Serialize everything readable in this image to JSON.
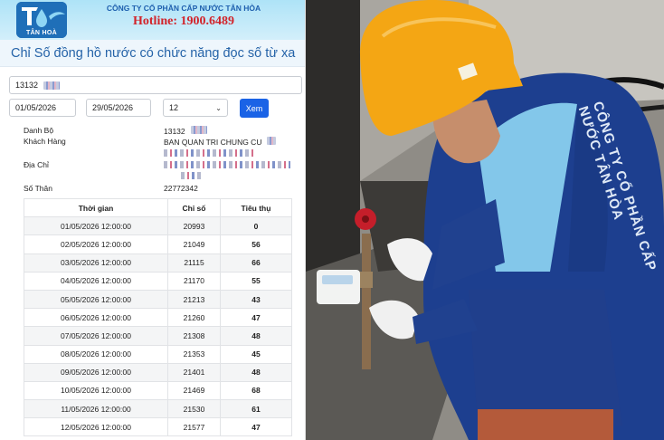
{
  "header": {
    "logo_text": "TÂN HOÀ",
    "company_name": "CÔNG TY CỔ PHẦN CẤP NƯỚC TÂN HÒA",
    "hotline": "Hotline: 1900.6489"
  },
  "page_title": "Chỉ Số đồng hồ nước có chức năng đọc số từ xa",
  "filters": {
    "account_value": "13132",
    "from_date": "01/05/2026",
    "to_date": "29/05/2026",
    "hour_value": "12",
    "search_button": "Xem"
  },
  "info": {
    "danh_bo_label": "Danh Bộ",
    "danh_bo_value": "13132",
    "customer_label": "Khách Hàng",
    "customer_value": "BAN QUAN TRI CHUNG CU",
    "address_label": "Địa Chỉ",
    "serial_label": "Số Thân",
    "serial_value": "22772342"
  },
  "table": {
    "headers": [
      "Thời gian",
      "Chỉ số",
      "Tiêu thụ"
    ],
    "rows": [
      [
        "01/05/2026 12:00:00",
        "20993",
        "0"
      ],
      [
        "02/05/2026 12:00:00",
        "21049",
        "56"
      ],
      [
        "03/05/2026 12:00:00",
        "21115",
        "66"
      ],
      [
        "04/05/2026 12:00:00",
        "21170",
        "55"
      ],
      [
        "05/05/2026 12:00:00",
        "21213",
        "43"
      ],
      [
        "06/05/2026 12:00:00",
        "21260",
        "47"
      ],
      [
        "07/05/2026 12:00:00",
        "21308",
        "48"
      ],
      [
        "08/05/2026 12:00:00",
        "21353",
        "45"
      ],
      [
        "09/05/2026 12:00:00",
        "21401",
        "48"
      ],
      [
        "10/05/2026 12:00:00",
        "21469",
        "68"
      ],
      [
        "11/05/2026 12:00:00",
        "21530",
        "61"
      ],
      [
        "12/05/2026 12:00:00",
        "21577",
        "47"
      ]
    ]
  },
  "photo": {
    "jacket_print": "CÔNG TY CỔ PHẦN CẤP NƯỚC TÂN HÒA",
    "colors": {
      "helmet": "#f4a614",
      "uniform": "#1d3f8f",
      "trim": "#8fd6f4"
    }
  }
}
